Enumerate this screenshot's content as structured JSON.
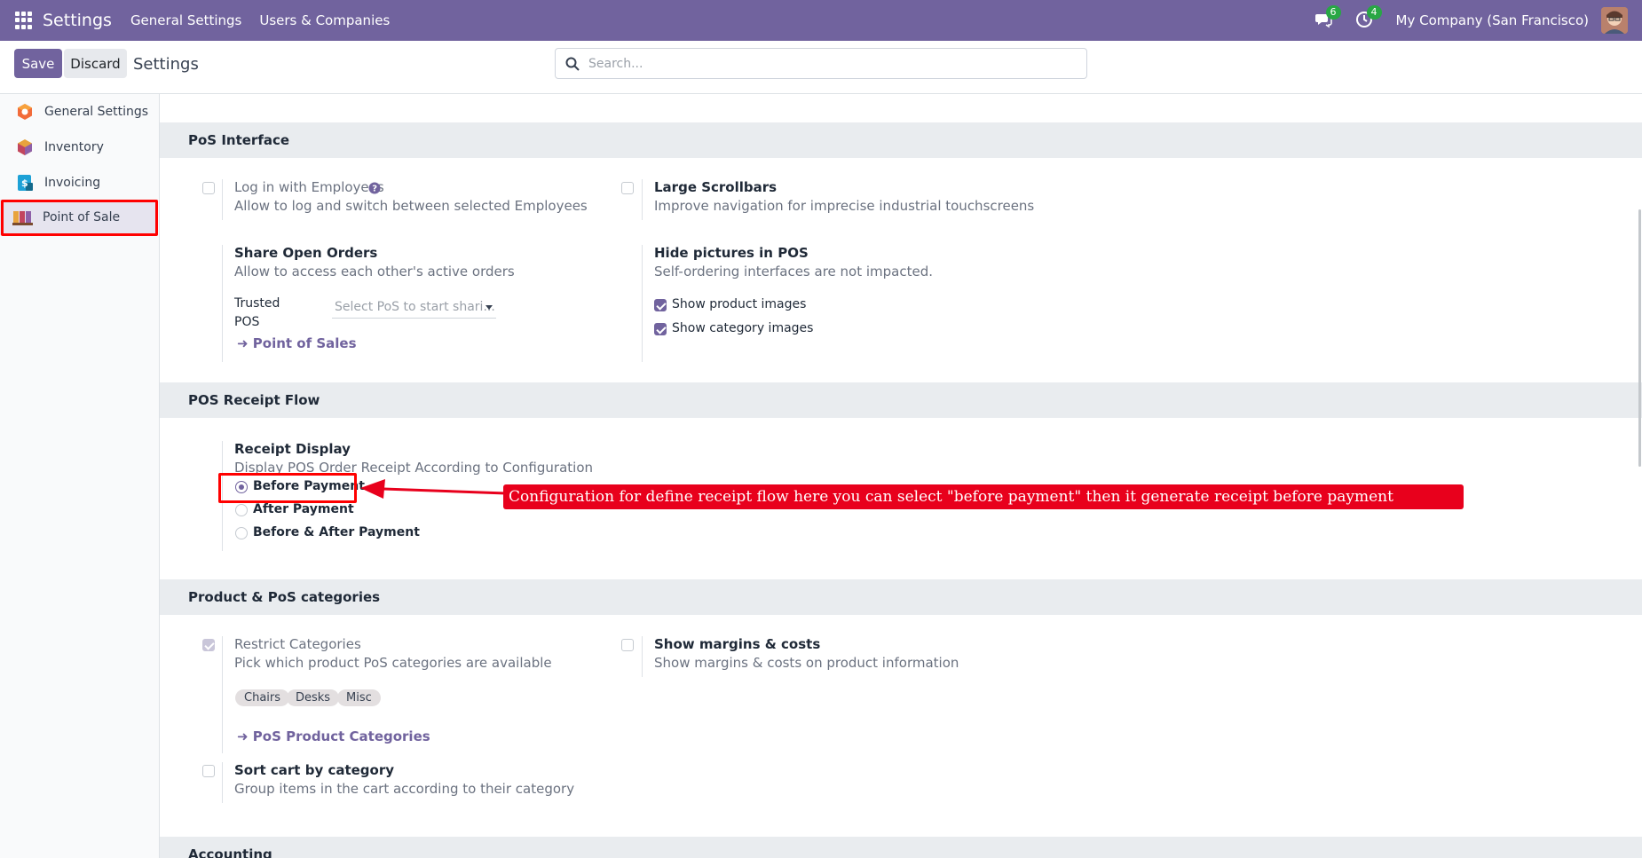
{
  "topbar": {
    "brand": "Settings",
    "menu": [
      "General Settings",
      "Users & Companies"
    ],
    "messages_count": "6",
    "activity_count": "4",
    "company": "My Company (San Francisco)"
  },
  "controlbar": {
    "save_label": "Save",
    "discard_label": "Discard",
    "title": "Settings",
    "search_placeholder": "Search..."
  },
  "sidebar": {
    "items": [
      {
        "label": "General Settings",
        "icon": "general-settings-icon"
      },
      {
        "label": "Inventory",
        "icon": "inventory-icon"
      },
      {
        "label": "Invoicing",
        "icon": "invoicing-icon"
      },
      {
        "label": "Point of Sale",
        "icon": "point-of-sale-icon"
      }
    ]
  },
  "pos_interface": {
    "header": "PoS Interface",
    "login_employees": {
      "title": "Log in with Employees",
      "desc": "Allow to log and switch between selected Employees"
    },
    "large_scrollbars": {
      "title": "Large Scrollbars",
      "desc": "Improve navigation for imprecise industrial touchscreens"
    },
    "share_orders": {
      "title": "Share Open Orders",
      "desc": "Allow to access each other's active orders",
      "trusted_label_1": "Trusted",
      "trusted_label_2": "POS",
      "select_placeholder": "Select PoS to start shari...",
      "link": "Point of Sales"
    },
    "hide_pictures": {
      "title": "Hide pictures in POS",
      "desc": "Self-ordering interfaces are not impacted.",
      "option1": "Show product images",
      "option2": "Show category images"
    }
  },
  "receipt_flow": {
    "header": "POS Receipt Flow",
    "title": "Receipt Display",
    "desc": "Display POS Order Receipt According to Configuration",
    "options": [
      "Before Payment",
      "After Payment",
      "Before & After Payment"
    ],
    "selected": "Before Payment"
  },
  "annotation": {
    "text": "Configuration for define receipt flow here you can select \"before payment\"  then it generate receipt before payment",
    "color": "#e8001c"
  },
  "product_categories": {
    "header": "Product & PoS categories",
    "restrict": {
      "title": "Restrict Categories",
      "desc": "Pick which product PoS categories are available",
      "tags": [
        "Chairs",
        "Desks",
        "Misc"
      ],
      "link": "PoS Product Categories"
    },
    "margins": {
      "title": "Show margins & costs",
      "desc": "Show margins & costs on product information"
    },
    "sort_cart": {
      "title": "Sort cart by category",
      "desc": "Group items in the cart according to their category"
    }
  },
  "accounting": {
    "header": "Accounting"
  },
  "colors": {
    "brand": "#71639e",
    "highlight": "#ff0000"
  }
}
